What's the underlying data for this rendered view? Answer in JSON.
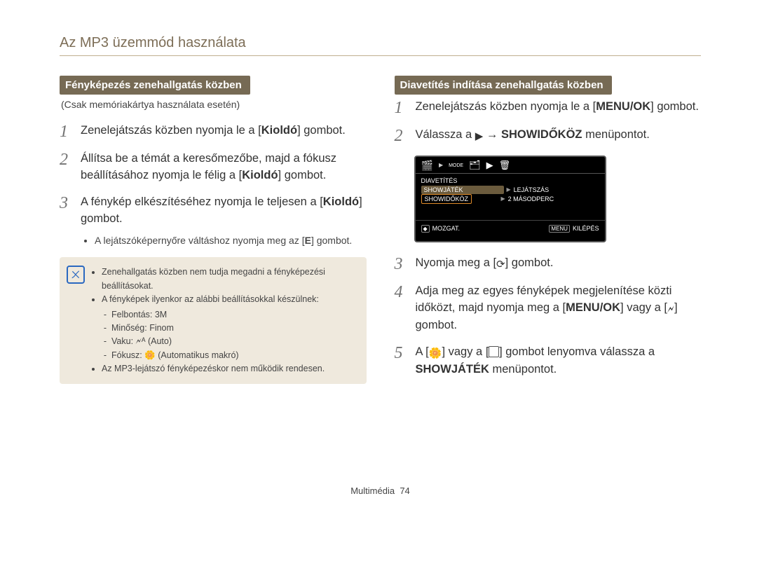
{
  "page_title": "Az MP3 üzemmód használata",
  "left": {
    "section_title": "Fényképezés zenehallgatás közben",
    "subnote": "(Csak memóriakártya használata esetén)",
    "steps": {
      "1": "Zenelejátszás közben nyomja le a [<b>Kioldó</b>] gombot.",
      "2": "Állítsa be a témát a keresőmezőbe, majd a fókusz beállításához nyomja le félig a [<b>Kioldó</b>] gombot.",
      "3": "A fénykép elkészítéséhez nyomja le teljesen a [<b>Kioldó</b>] gombot.",
      "3_bullet": "A lejátszóképernyőre váltáshoz nyomja meg az [<b>E</b>] gombot."
    },
    "info": {
      "b1": "Zenehallgatás közben nem tudja megadni a fényképezési beállításokat.",
      "b2": "A fényképek ilyenkor az alábbi beállításokkal készülnek:",
      "s1": "Felbontás: 3M",
      "s2": "Minőség: Finom",
      "s3": "Vaku: 🗲ᴬ (Auto)",
      "s4": "Fókusz: 🌼 (Automatikus makró)",
      "b3": "Az MP3-lejátszó fényképezéskor nem működik rendesen."
    }
  },
  "right": {
    "section_title": "Diavetítés indítása zenehallgatás közben",
    "steps": {
      "1": "Zenelejátszás közben nyomja le a [<b>MENU/OK</b>] gombot.",
      "2": "Válassza a <span class='icon-inline'>▶</span> → <b>SHOWIDŐKÖZ</b> menüpontot.",
      "3": "Nyomja meg a [<span class='icon-inline'>⟳</span>] gombot.",
      "4": "Adja meg az egyes fényképek megjelenítése közti időközt, majd nyomja meg a [<b>MENU/OK</b>] vagy a [<span class='icon-inline'>🗲</span>] gombot.",
      "5": "A [<span class='icon-inline'>🌼</span>] vagy a [<span class='kbox'>&nbsp;&nbsp;</span>] gombot lenyomva válassza a <b>SHOWJÁTÉK</b> menüpontot."
    }
  },
  "lcd": {
    "mode": "MODE",
    "r1": "DIAVETÍTÉS",
    "r2_l": "SHOWJÁTÉK",
    "r2_r": "LEJÁTSZÁS",
    "r3_l": "SHOWIDŐKÖZ",
    "r3_r": "2 MÁSODPERC",
    "foot_move": "MOZGAT.",
    "foot_menu": "MENU",
    "foot_exit": "KILÉPÉS"
  },
  "footer_label": "Multimédia",
  "footer_page": "74"
}
